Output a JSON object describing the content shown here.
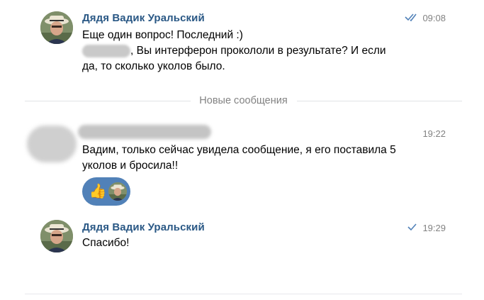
{
  "messages": [
    {
      "author": "Дядя Вадик Уральский",
      "time": "09:08",
      "status_icon": "double-check-icon",
      "line1": "Еще один вопрос! Последний :)",
      "line2_visible": ", Вы интерферон прокололи в результате? И если",
      "line3": "да, то сколько уколов было."
    },
    {
      "author": "",
      "time": "19:22",
      "line1": "Вадим, только сейчас увидела сообщение, я его поставила 5",
      "line2": "уколов и бросила!!",
      "reaction_icon": "thumbs-up-icon"
    },
    {
      "author": "Дядя Вадик Уральский",
      "time": "19:29",
      "status_icon": "check-icon",
      "line1": "Спасибо!"
    }
  ],
  "divider": {
    "label": "Новые сообщения"
  },
  "colors": {
    "author": "#2a5885",
    "accent": "#5181b8",
    "muted": "#828282",
    "divider": "#e1e3e6"
  }
}
